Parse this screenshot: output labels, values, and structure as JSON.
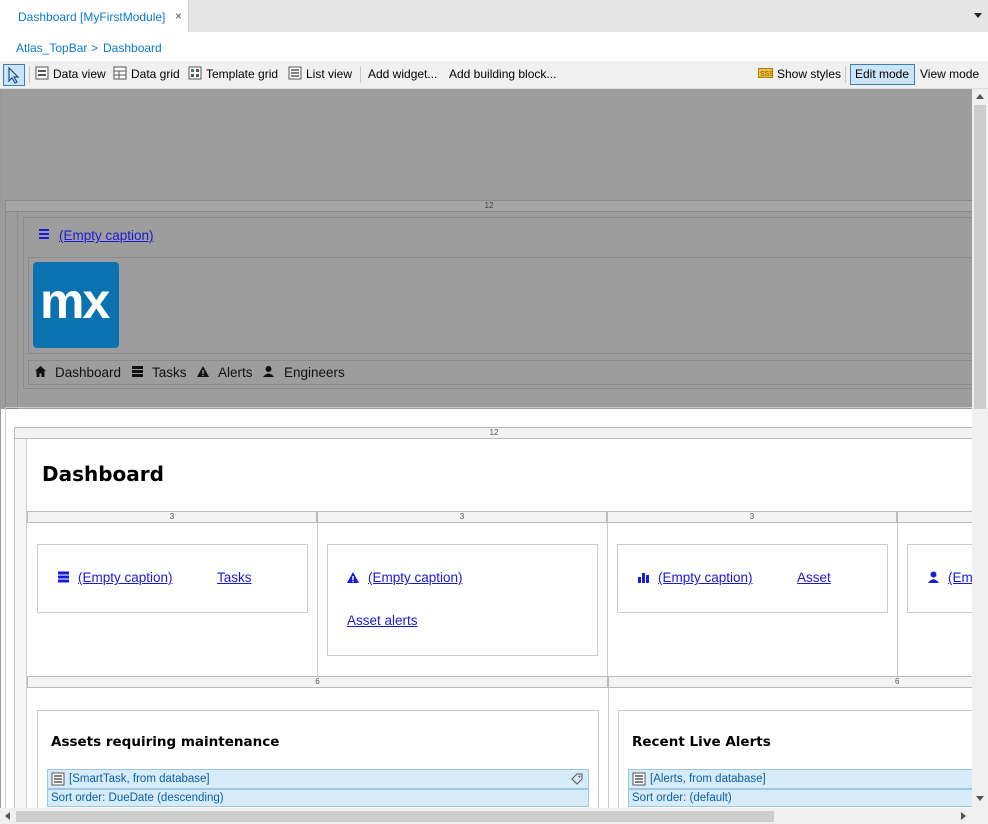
{
  "tabs": [
    {
      "label": "Dashboard [MyFirstModule]",
      "close": "×"
    }
  ],
  "breadcrumb": {
    "parent": "Atlas_TopBar",
    "separator": ">",
    "current": "Dashboard"
  },
  "toolbar": {
    "data_view": "Data view",
    "data_grid": "Data grid",
    "template_grid": "Template grid",
    "list_view": "List view",
    "add_widget": "Add widget...",
    "add_building_block": "Add building block...",
    "show_styles": "Show styles",
    "edit_mode": "Edit mode",
    "view_mode": "View mode"
  },
  "layout": {
    "topbar_col": "12",
    "menu_caption": "(Empty caption)",
    "logo_text": "mx",
    "nav_items": [
      "Dashboard",
      "Tasks",
      "Alerts",
      "Engineers"
    ]
  },
  "main": {
    "col_12": "12",
    "title": "Dashboard",
    "col_3": [
      "3",
      "3",
      "3"
    ],
    "cards": [
      {
        "caption": "(Empty caption)",
        "link": "Tasks"
      },
      {
        "caption": "(Empty caption)",
        "link": "Asset alerts"
      },
      {
        "caption": "(Empty caption)",
        "link": "Asset"
      },
      {
        "caption": "(Em"
      }
    ],
    "col_6": [
      "6",
      "6"
    ],
    "panels": [
      {
        "title": "Assets requiring maintenance",
        "source": "[SmartTask, from database]",
        "sort": "Sort order: DueDate (descending)"
      },
      {
        "title": "Recent Live Alerts",
        "source": "[Alerts, from database]",
        "sort": "Sort order: (default)"
      }
    ]
  }
}
